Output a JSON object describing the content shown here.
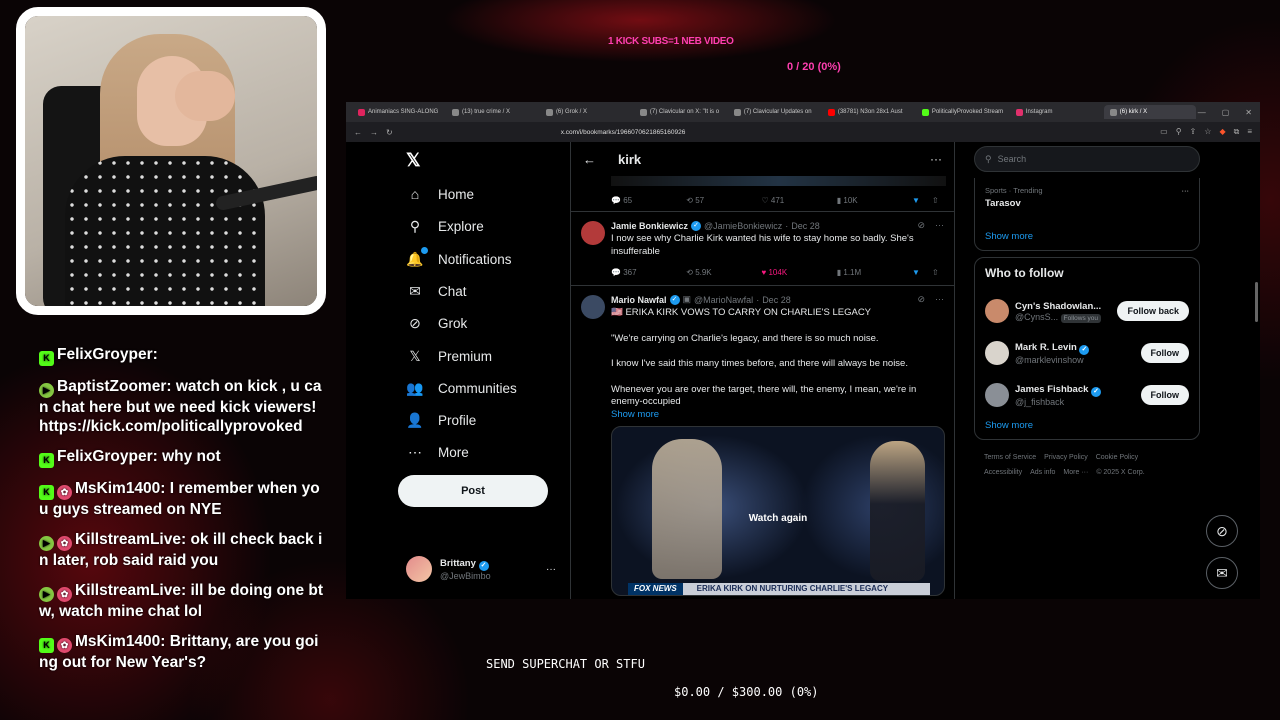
{
  "overlay": {
    "sub_goal": "1 KICK SUBS=1 NEB VIDEO",
    "sub_count": "0 / 20 (0%)",
    "superchat_label": "SEND SUPERCHAT OR STFU",
    "superchat_goal": "$0.00 / $300.00 (0%)"
  },
  "chat": [
    {
      "platform": "kick",
      "user": "FelixGroyper:",
      "text": "",
      "badge": ""
    },
    {
      "platform": "rumble",
      "user": "BaptistZoomer:",
      "text": "watch on kick , u can chat here but we need kick viewers! https://kick.com/politicallyprovoked",
      "badge": ""
    },
    {
      "platform": "kick",
      "user": "FelixGroyper:",
      "text": "why not",
      "badge": ""
    },
    {
      "platform": "kick",
      "user": "MsKim1400:",
      "text": "I remember when you guys streamed on NYE",
      "badge": "mod"
    },
    {
      "platform": "rumble",
      "user": "KillstreamLive:",
      "text": "ok ill check back in later, rob said raid you",
      "badge": "mod"
    },
    {
      "platform": "rumble",
      "user": "KillstreamLive:",
      "text": "ill be doing one btw, watch mine chat lol",
      "badge": "mod"
    },
    {
      "platform": "kick",
      "user": "MsKim1400:",
      "text": "Brittany, are you going out for New Year's?",
      "badge": "mod"
    }
  ],
  "browser": {
    "tabs": [
      {
        "label": "Animaniacs SING-ALONG",
        "color": "#e0245e"
      },
      {
        "label": "(13) true crime / X",
        "color": "#888888"
      },
      {
        "label": "(6) Grok / X",
        "color": "#888888"
      },
      {
        "label": "(7) Clavicular on X: \"It is o",
        "color": "#888888"
      },
      {
        "label": "(7) Clavicular Updates on",
        "color": "#888888"
      },
      {
        "label": "(38781) N3on 28x1 Aust",
        "color": "#ff0000"
      },
      {
        "label": "PoliticallyProvoked Stream",
        "color": "#53fc18"
      },
      {
        "label": "Instagram",
        "color": "#e1306c"
      },
      {
        "label": "(6) kirk / X",
        "color": "#888888",
        "active": true
      }
    ],
    "url": "x.com/i/bookmarks/1966070621865160926"
  },
  "x_nav": {
    "items": [
      {
        "label": "Home",
        "icon": "home-icon",
        "glyph": "⌂"
      },
      {
        "label": "Explore",
        "icon": "search-icon",
        "glyph": "⚲"
      },
      {
        "label": "Notifications",
        "icon": "bell-icon",
        "glyph": "🔔"
      },
      {
        "label": "Chat",
        "icon": "mail-icon",
        "glyph": "✉"
      },
      {
        "label": "Grok",
        "icon": "grok-icon",
        "glyph": "⊘"
      },
      {
        "label": "Premium",
        "icon": "x-icon",
        "glyph": "𝕏"
      },
      {
        "label": "Communities",
        "icon": "people-icon",
        "glyph": "👥"
      },
      {
        "label": "Profile",
        "icon": "person-icon",
        "glyph": "👤"
      },
      {
        "label": "More",
        "icon": "more-icon",
        "glyph": "⋯"
      }
    ],
    "post_label": "Post",
    "user": {
      "name": "Brittany",
      "handle": "@JewBimbo"
    }
  },
  "feed": {
    "title": "kirk",
    "prev_actions": {
      "replies": "65",
      "reposts": "57",
      "likes": "471",
      "views": "10K"
    },
    "tweets": [
      {
        "name": "Jamie Bonkiewicz",
        "handle": "@JamieBonkiewicz",
        "date": "Dec 28",
        "text": "I now see why Charlie Kirk wanted his wife to stay home so badly. She's insufferable",
        "replies": "367",
        "reposts": "5.9K",
        "likes": "104K",
        "views": "1.1M",
        "avatar_color": "#b33a3a"
      },
      {
        "name": "Mario Nawfal",
        "handle": "@MarioNawfal",
        "date": "Dec 28",
        "headline": "🇺🇸 ERIKA KIRK VOWS TO CARRY ON CHARLIE'S LEGACY",
        "paragraphs": [
          "\"We're carrying on Charlie's legacy, and there is so much noise.",
          "I know I've said this many times before, and there will always be noise.",
          "Whenever you are over the target, there will, the enemy, I mean, we're in enemy-occupied"
        ],
        "show_more": "Show more",
        "video_label": "Watch again",
        "chyron_brand": "FOX NEWS",
        "chyron_text": "ERIKA KIRK ON NURTURING CHARLIE'S LEGACY",
        "avatar_color": "#3b4a63"
      }
    ]
  },
  "right": {
    "search_placeholder": "Search",
    "trend": {
      "category": "Sports · Trending",
      "name": "Tarasov",
      "show_more": "Show more"
    },
    "who_to_follow": {
      "title": "Who to follow",
      "people": [
        {
          "name": "Cyn's Shadowlan...",
          "handle": "@CynsS...",
          "follows_you": "Follows you",
          "button": "Follow back",
          "color": "#c98a6b"
        },
        {
          "name": "Mark R. Levin",
          "handle": "@marklevinshow",
          "follows_you": "",
          "button": "Follow",
          "color": "#d9d4cc"
        },
        {
          "name": "James Fishback",
          "handle": "@j_fishback",
          "follows_you": "",
          "button": "Follow",
          "color": "#8a8f96"
        }
      ],
      "show_more": "Show more"
    },
    "footer": [
      "Terms of Service",
      "Privacy Policy",
      "Cookie Policy",
      "Accessibility",
      "Ads info",
      "More ···",
      "© 2025 X Corp."
    ]
  }
}
